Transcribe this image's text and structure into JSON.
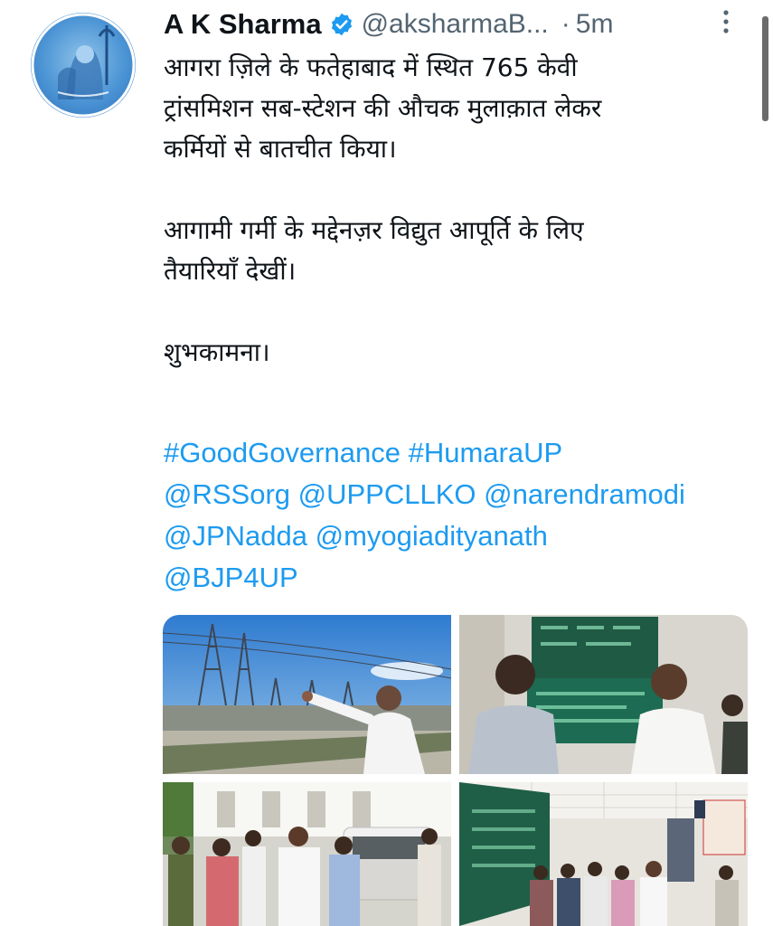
{
  "tweet": {
    "author_name": "A K Sharma",
    "handle": "@aksharmaB...",
    "separator": "·",
    "time": "5m",
    "verified": true,
    "avatar_icon": "shiva-avatar",
    "text_paragraphs": [
      [
        "आगरा ज़िले के फतेहाबाद में स्थित 765  केवी",
        "ट्रांसमिशन सब-स्टेशन की औचक मुलाक़ात लेकर",
        "कर्मियों से बातचीत किया।"
      ],
      [
        "आगामी गर्मी के मद्देनज़र विद्युत आपूर्ति के लिए",
        "तैयारियाँ देखीं।"
      ],
      [
        "शुभकामना।"
      ]
    ],
    "hashtags": [
      "#GoodGovernance",
      "#HumaraUP"
    ],
    "mentions": [
      "@RSSorg",
      "@UPPCLLKO",
      "@narendramodi",
      "@JPNadda",
      "@myogiadityanath",
      "@BJP4UP"
    ],
    "media": [
      {
        "icon": "substation-visit-photo"
      },
      {
        "icon": "control-room-discussion-photo"
      },
      {
        "icon": "group-walk-photo"
      },
      {
        "icon": "control-room-group-photo"
      }
    ],
    "colors": {
      "link": "#1d9bf0",
      "verified": "#1d9bf0",
      "secondary_text": "#536471",
      "primary_text": "#0f1419"
    }
  }
}
